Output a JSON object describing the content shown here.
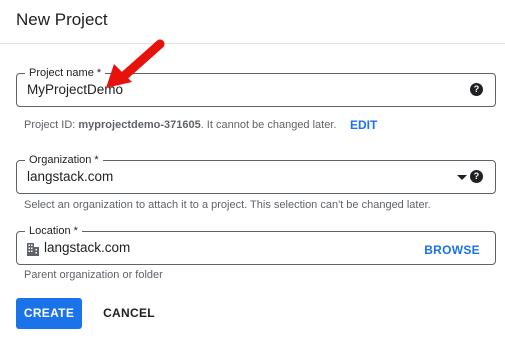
{
  "dialog": {
    "title": "New Project"
  },
  "project_name": {
    "label": "Project name *",
    "value": "MyProjectDemo",
    "help_icon": "help-circle-icon",
    "hint_prefix": "Project ID: ",
    "hint_id": "myprojectdemo-371605",
    "hint_suffix": ". It cannot be changed later.",
    "edit_label": "EDIT"
  },
  "organization": {
    "label": "Organization *",
    "value": "langstack.com",
    "help_icon": "help-circle-icon",
    "dropdown_icon": "caret-down-icon",
    "hint": "Select an organization to attach it to a project. This selection can't be changed later."
  },
  "location": {
    "label": "Location *",
    "value": "langstack.com",
    "icon": "building-icon",
    "browse_label": "BROWSE",
    "hint": "Parent organization or folder"
  },
  "actions": {
    "create_label": "CREATE",
    "cancel_label": "CANCEL"
  },
  "colors": {
    "accent": "#1a73e8",
    "annotation_arrow": "#e8120c"
  }
}
